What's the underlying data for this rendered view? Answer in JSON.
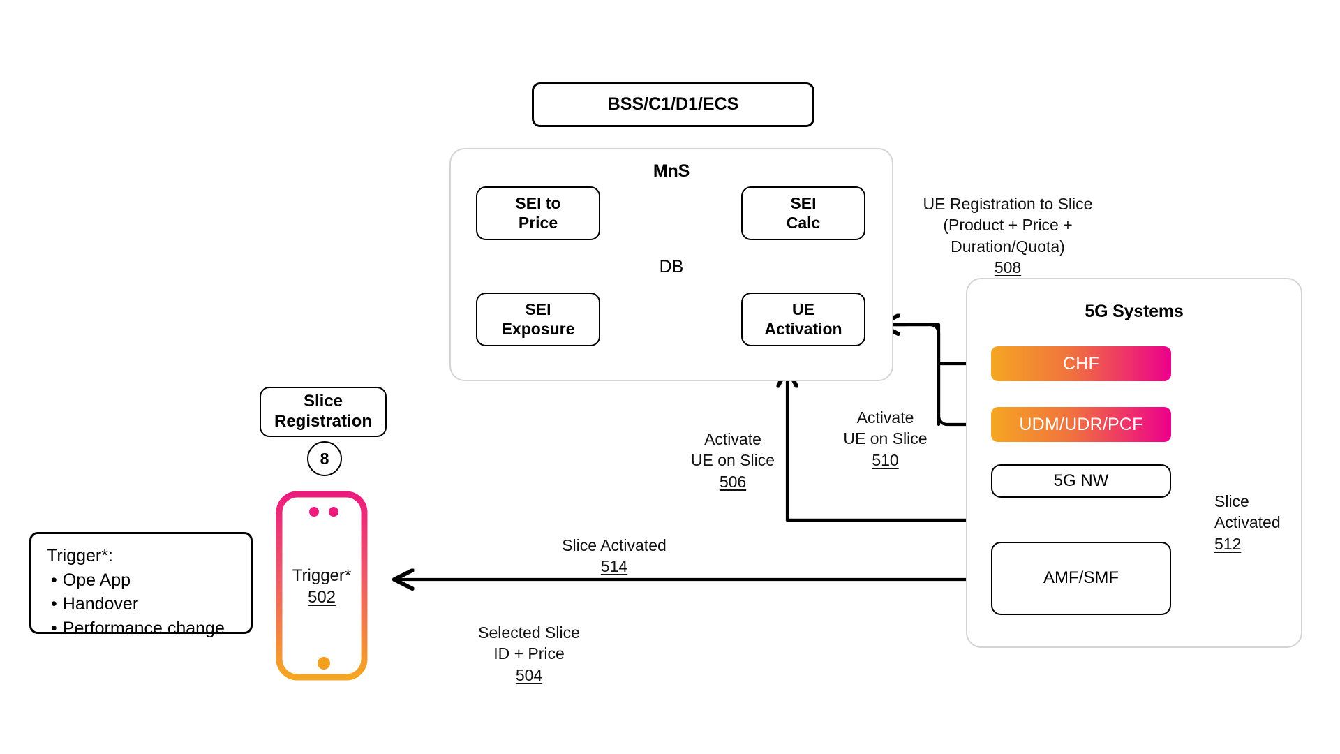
{
  "diagram": {
    "title_top": "BSS/C1/D1/ECS",
    "mns": {
      "title": "MnS",
      "boxes": [
        {
          "id": "sei-to-price",
          "label": "SEI to\nPrice"
        },
        {
          "id": "sei-calc",
          "label": "SEI\nCalc"
        },
        {
          "id": "sei-exposure",
          "label": "SEI\nExposure"
        },
        {
          "id": "ue-activation",
          "label": "UE\nActivation"
        }
      ],
      "db_label": "DB"
    },
    "fiveg": {
      "title": "5G Systems",
      "pills": [
        {
          "id": "chf",
          "label": "CHF"
        },
        {
          "id": "udm-udr-pcf",
          "label": "UDM/UDR/PCF"
        }
      ],
      "boxes": [
        {
          "id": "5g-nw",
          "label": "5G NW"
        },
        {
          "id": "amf-smf",
          "label": "AMF/SMF"
        }
      ]
    },
    "slice_registration": {
      "label": "Slice\nRegistration",
      "badge": "8"
    },
    "phone": {
      "label": "Trigger*",
      "number": "502"
    },
    "legend": {
      "title": "Trigger*:",
      "items": [
        "Ope App",
        "Handover",
        "Performance change"
      ]
    },
    "flow_labels": [
      {
        "id": "selected-slice",
        "text": "Selected Slice\nID + Price",
        "number": "504"
      },
      {
        "id": "activate-ue-506",
        "text": "Activate\nUE on Slice",
        "number": "506"
      },
      {
        "id": "ue-registration-508",
        "text": "UE Registration to Slice\n(Product + Price +\nDuration/Quota)",
        "number": "508"
      },
      {
        "id": "activate-ue-510",
        "text": "Activate\nUE on Slice",
        "number": "510"
      },
      {
        "id": "slice-activated-512",
        "text": "Slice\nActivated",
        "number": "512"
      },
      {
        "id": "slice-activated-514",
        "text": "Slice Activated",
        "number": "514"
      }
    ],
    "colors": {
      "gradient_start": "#f5a623",
      "gradient_mid": "#f07a3c",
      "gradient_end": "#ec008c",
      "phone_top": "#ec1c7d",
      "phone_bottom": "#f5a623",
      "stroke": "#000000",
      "container_stroke": "#d4d4d4"
    }
  }
}
